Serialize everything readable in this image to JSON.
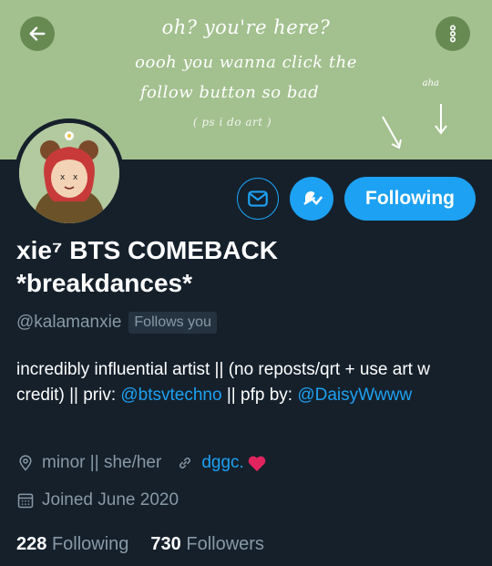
{
  "banner": {
    "line1": "oh? you're here?",
    "line2": "oooh you wanna click the",
    "line3": "follow button so bad",
    "line4": "( ps i do art )",
    "small_label": "aha",
    "bg_color": "#a3c08f"
  },
  "icons": {
    "back": "back-arrow-icon",
    "more": "more-vertical-icon",
    "message": "envelope-icon",
    "notifications": "bell-check-icon",
    "location": "location-pin-icon",
    "link": "link-icon",
    "calendar": "calendar-icon",
    "heart": "heart-icon"
  },
  "profile": {
    "name": "xie⁷ BTS COMEBACK *breakdances*",
    "handle": "@kalamanxie",
    "follows_you": "Follows you",
    "follow_button": "Following",
    "bio": {
      "part1": "incredibly influential artist || (no reposts/qrt + use art w credit) || priv: ",
      "link1": "@btsvtechno",
      "part2": " || pfp by: ",
      "link2": "@DaisyWwww"
    },
    "location": "minor || she/her",
    "website": "dggc.",
    "joined": "Joined June 2020",
    "following_count": "228",
    "following_label": "Following",
    "followers_count": "730",
    "followers_label": "Followers"
  },
  "colors": {
    "background": "#15202b",
    "accent": "#1da1f2",
    "muted": "#8899a6",
    "heart": "#e0245e"
  }
}
